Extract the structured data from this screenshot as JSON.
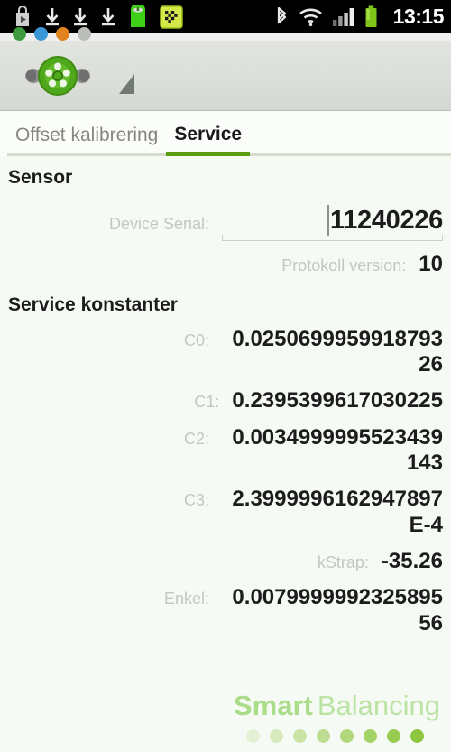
{
  "statusbar": {
    "icons": [
      {
        "name": "market-bag-icon",
        "label": "Android Market"
      },
      {
        "name": "download-icon-1",
        "label": "Download"
      },
      {
        "name": "download-icon-2",
        "label": "Download"
      },
      {
        "name": "download-icon-3",
        "label": "Download"
      },
      {
        "name": "app-green-icon",
        "label": "Smart Balancing"
      },
      {
        "name": "checkered-flag-icon",
        "label": "Race app"
      },
      {
        "name": "bluetooth-icon",
        "label": "Bluetooth"
      },
      {
        "name": "wifi-icon",
        "label": "Wi-Fi"
      },
      {
        "name": "signal-icon",
        "label": "Mobile signal"
      },
      {
        "name": "battery-icon",
        "label": "Battery"
      }
    ],
    "clock": "13:15"
  },
  "notification_dots": [
    "#3e9b3e",
    "#3a96d6",
    "#e0821e",
    "#b9bcb7"
  ],
  "actionbar": {
    "app_icon_name": "wheel-rim-logo-icon",
    "spinner_caret_name": "spinner-caret-icon"
  },
  "tabs": [
    {
      "label": "Offset kalibrering",
      "active": false
    },
    {
      "label": "Service",
      "active": true
    }
  ],
  "sections": [
    {
      "title": "Sensor",
      "rows": [
        {
          "label": "Device Serial:",
          "value": "11240226",
          "type": "input",
          "name": "device-serial"
        },
        {
          "label": "Protokoll version:",
          "value": "10",
          "type": "text",
          "name": "protokoll-version"
        }
      ]
    },
    {
      "title": "Service konstanter",
      "rows": [
        {
          "label": "C0:",
          "value": "0.025069995991879326",
          "type": "text",
          "name": "constant-c0"
        },
        {
          "label": "C1:",
          "value": "0.2395399617030225",
          "type": "text",
          "name": "constant-c1"
        },
        {
          "label": "C2:",
          "value": "0.0034999995523439143",
          "type": "text",
          "name": "constant-c2"
        },
        {
          "label": "C3:",
          "value": "2.3999996162947897E-4",
          "type": "text",
          "name": "constant-c3"
        },
        {
          "label": "kStrap:",
          "value": "-35.26",
          "type": "text",
          "name": "constant-kstrap"
        },
        {
          "label": "Enkel:",
          "value": "0.007999999232589556",
          "type": "text",
          "name": "constant-enkel"
        }
      ]
    }
  ],
  "footer": {
    "brand_bold": "Smart",
    "brand_light": "Balancing",
    "dot_count": 8,
    "dot_color": "#8dc63f",
    "dot_opacities": [
      0.18,
      0.3,
      0.42,
      0.54,
      0.66,
      0.78,
      0.9,
      1.0
    ]
  },
  "colors": {
    "accent_green": "#5a9e10",
    "brand_green": "#8dc63f",
    "background": "#f6faf4",
    "label_gray": "#c3c7c0",
    "value_dark": "#1c1c1c"
  }
}
